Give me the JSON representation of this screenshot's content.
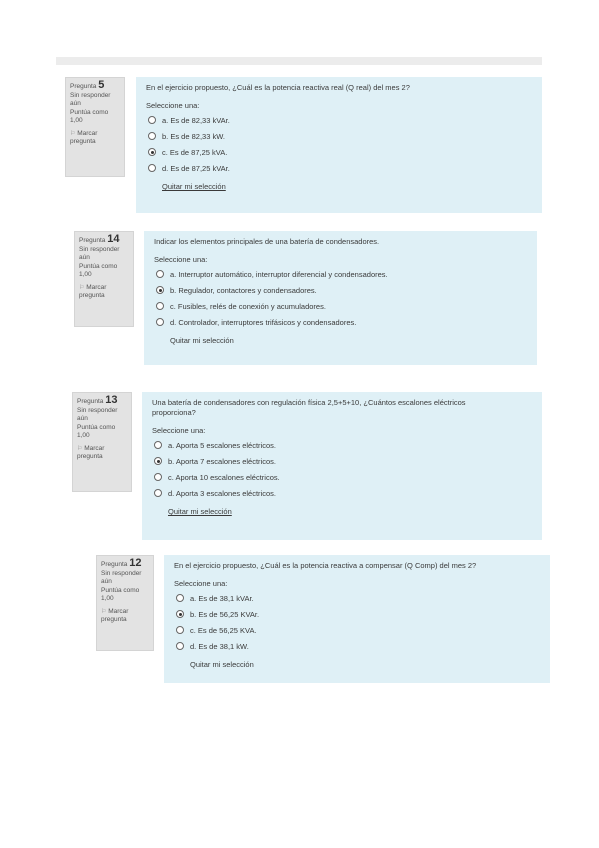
{
  "questions": [
    {
      "label": "Pregunta",
      "number": "5",
      "status": "Sin responder aún",
      "score": "Puntúa como 1,00",
      "flag": "Marcar pregunta",
      "text": "En el ejercicio propuesto, ¿Cuál es la potencia reactiva real (Q real) del mes 2?",
      "prompt": "Seleccione una:",
      "options": [
        "a. Es de 82,33 kVAr.",
        "b. Es de 82,33 kW.",
        "c. Es de 87,25 kVA.",
        "d. Es de 87,25 kVAr."
      ],
      "selected_option": "c",
      "clear": "Quitar mi selección"
    },
    {
      "label": "Pregunta",
      "number": "14",
      "status": "Sin responder aún",
      "score": "Puntúa como 1,00",
      "flag": "Marcar pregunta",
      "text": "Indicar los elementos principales de una batería de condensadores.",
      "prompt": "Seleccione una:",
      "options": [
        "a. Interruptor automático, interruptor diferencial y condensadores.",
        "b. Regulador, contactores y condensadores.",
        "c. Fusibles, relés de conexión y acumuladores.",
        "d. Controlador, interruptores trifásicos y condensadores."
      ],
      "selected_option": "b",
      "clear": "Quitar mi selección"
    },
    {
      "label": "Pregunta",
      "number": "13",
      "status": "Sin responder aún",
      "score": "Puntúa como 1,00",
      "flag": "Marcar pregunta",
      "text": "Una batería de condensadores con regulación física 2,5+5+10, ¿Cuántos escalones eléctricos proporciona?",
      "prompt": "Seleccione una:",
      "options": [
        "a. Aporta 5 escalones eléctricos.",
        "b. Aporta 7 escalones eléctricos.",
        "c. Aporta 10 escalones eléctricos.",
        "d. Aporta 3 escalones eléctricos."
      ],
      "selected_option": "b",
      "clear": "Quitar mi selección"
    },
    {
      "label": "Pregunta",
      "number": "12",
      "status": "Sin responder aún",
      "score": "Puntúa como 1,00",
      "flag": "Marcar pregunta",
      "text": "En el ejercicio propuesto, ¿Cuál es la potencia reactiva a compensar (Q Comp) del mes 2?",
      "prompt": "Seleccione una:",
      "options": [
        "a. Es de 38,1 kVAr.",
        "b. Es de 56,25 KVAr.",
        "c. Es de 56,25 KVA.",
        "d. Es de 38,1 kW."
      ],
      "selected_option": "b",
      "clear": "Quitar mi selección"
    }
  ],
  "colors": {
    "content_bg": "#dff0f6",
    "info_bg": "#e3e3e3"
  },
  "icons": {
    "flag": "flag-icon",
    "radio": "radio-button"
  }
}
